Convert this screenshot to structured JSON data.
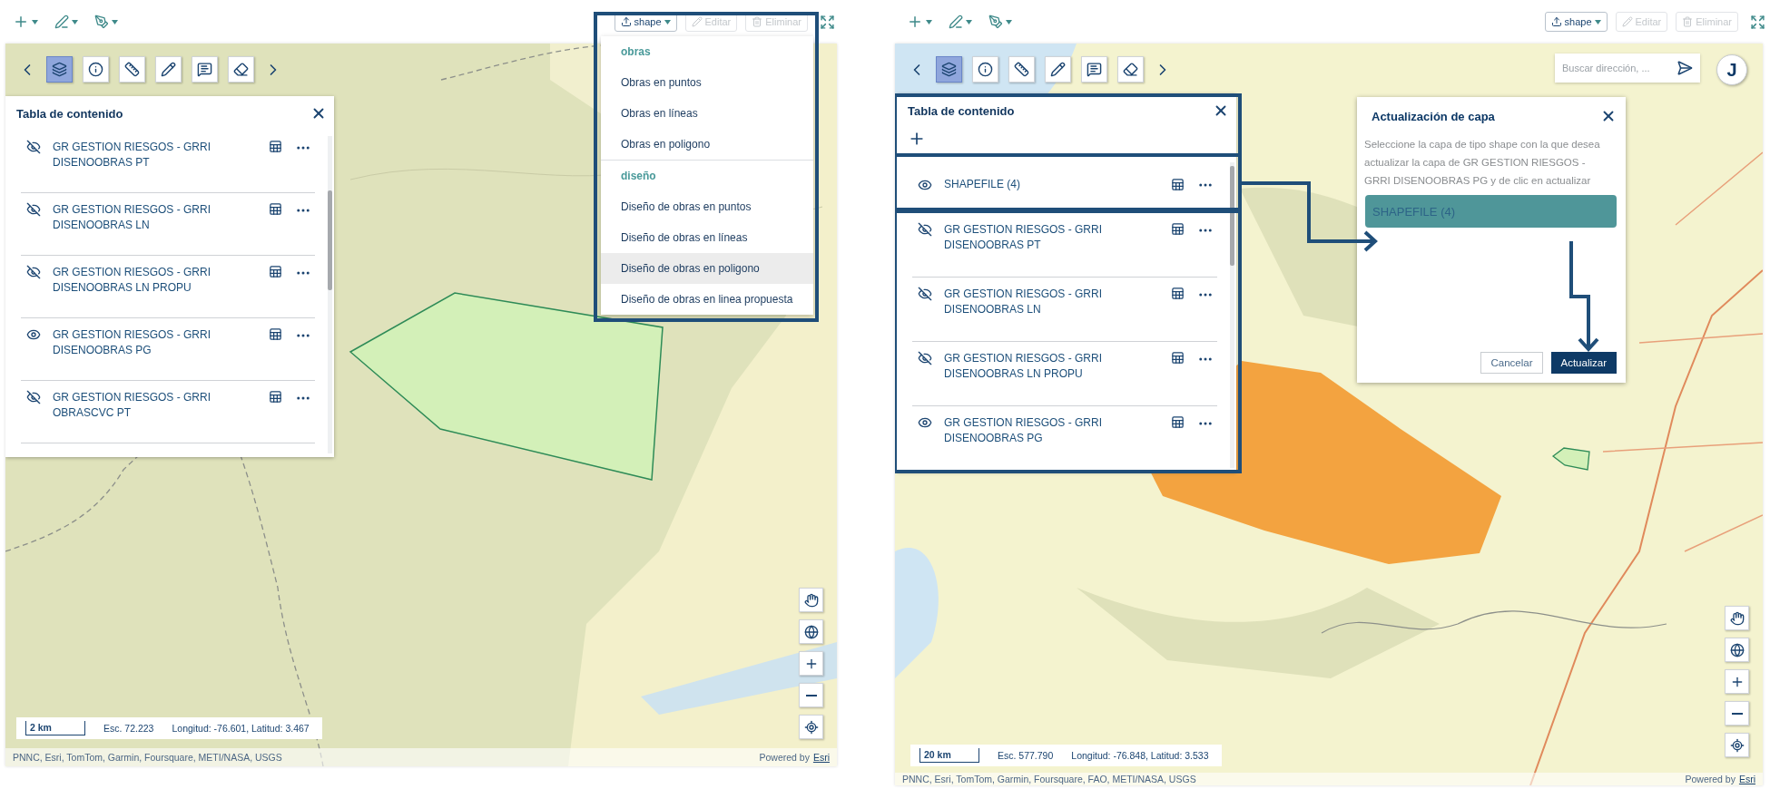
{
  "screens": [
    {
      "actions": [
        {
          "kind": "upload-menu",
          "label": "shape",
          "disabled": false
        },
        {
          "kind": "edit",
          "label": "Editar",
          "disabled": true
        },
        {
          "kind": "delete",
          "label": "Eliminar",
          "disabled": true
        }
      ],
      "widgets": [
        {
          "kind": "layers",
          "selected": true
        },
        {
          "kind": "info",
          "selected": false
        },
        {
          "kind": "measure",
          "selected": false
        },
        {
          "kind": "draw",
          "selected": false
        },
        {
          "kind": "comment",
          "selected": false
        },
        {
          "kind": "erase",
          "selected": false
        }
      ],
      "toc": {
        "title": "Tabla de contenido",
        "layers": [
          {
            "name": "GR GESTION RIESGOS - GRRI DISENOOBRAS PT",
            "visible": false
          },
          {
            "name": "GR GESTION RIESGOS - GRRI DISENOOBRAS LN",
            "visible": false
          },
          {
            "name": "GR GESTION RIESGOS - GRRI DISENOOBRAS LN PROPU",
            "visible": false
          },
          {
            "name": "GR GESTION RIESGOS - GRRI DISENOOBRAS PG",
            "visible": true
          },
          {
            "name": "GR GESTION RIESGOS - GRRI OBRASCVC PT",
            "visible": false
          }
        ]
      },
      "shape_menu": {
        "groups": [
          {
            "title": "obras",
            "items": [
              {
                "label": "Obras en puntos",
                "selected": false
              },
              {
                "label": "Obras en líneas",
                "selected": false
              },
              {
                "label": "Obras en poligono",
                "selected": false
              }
            ]
          },
          {
            "title": "diseño",
            "items": [
              {
                "label": "Diseño de obras en puntos",
                "selected": false
              },
              {
                "label": "Diseño de obras en líneas",
                "selected": false
              },
              {
                "label": "Diseño de obras en poligono",
                "selected": true
              },
              {
                "label": "Diseño de obras en linea propuesta",
                "selected": false
              }
            ]
          }
        ]
      },
      "map": {
        "kind": "picture"
      },
      "scale": {
        "distance": "2 km",
        "ratio": "Esc. 72.223",
        "coordinates": "Longitud: -76.601, Latitud: 3.467"
      },
      "attribution": {
        "sources": "PNNC, Esri, TomTom, Garmin, Foursquare, METI/NASA, USGS",
        "powered_by": "Powered by",
        "link": "Esri"
      }
    },
    {
      "actions": [
        {
          "kind": "upload-menu",
          "label": "shape",
          "disabled": false
        },
        {
          "kind": "edit",
          "label": "Editar",
          "disabled": true
        },
        {
          "kind": "delete",
          "label": "Eliminar",
          "disabled": true
        }
      ],
      "widgets": [
        {
          "kind": "layers",
          "selected": true
        },
        {
          "kind": "info",
          "selected": false
        },
        {
          "kind": "measure",
          "selected": false
        },
        {
          "kind": "draw",
          "selected": false
        },
        {
          "kind": "comment",
          "selected": false
        },
        {
          "kind": "erase",
          "selected": false
        }
      ],
      "search": {
        "placeholder": "Buscar dirección, ..."
      },
      "avatar": "J",
      "toc": {
        "title": "Tabla de contenido",
        "layers": [
          {
            "name": "SHAPEFILE (4)",
            "visible": true
          },
          {
            "name": "GR GESTION RIESGOS - GRRI DISENOOBRAS PT",
            "visible": false
          },
          {
            "name": "GR GESTION RIESGOS - GRRI DISENOOBRAS LN",
            "visible": false
          },
          {
            "name": "GR GESTION RIESGOS - GRRI DISENOOBRAS LN PROPU",
            "visible": false
          },
          {
            "name": "GR GESTION RIESGOS - GRRI DISENOOBRAS PG",
            "visible": true
          }
        ]
      },
      "dialog": {
        "title": "Actualización de capa",
        "text": "Seleccione la capa de tipo shape con la que desea actualizar la capa de GR GESTION RIESGOS - GRRI DISENOOBRAS PG y de clic en actualizar",
        "options": [
          {
            "label": "SHAPEFILE (4)",
            "selected": true
          }
        ],
        "buttons": [
          {
            "kind": "secondary",
            "label": "Cancelar"
          },
          {
            "kind": "primary",
            "label": "Actualizar"
          }
        ]
      },
      "map": {
        "kind": "picture"
      },
      "scale": {
        "distance": "20 km",
        "ratio": "Esc. 577.790",
        "coordinates": "Longitud: -76.848, Latitud: 3.533"
      },
      "attribution": {
        "sources": "PNNC, Esri, TomTom, Garmin, Foursquare, FAO, METI/NASA, USGS",
        "powered_by": "Powered by",
        "link": "Esri"
      }
    }
  ]
}
